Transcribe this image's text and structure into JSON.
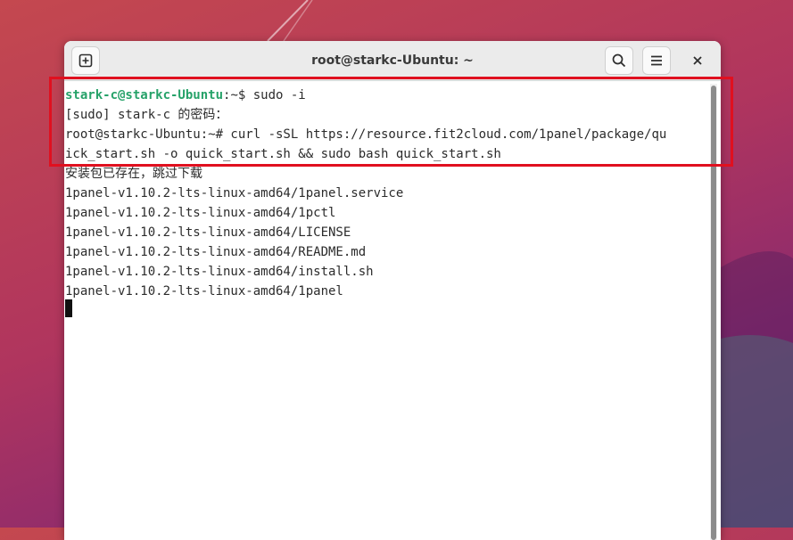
{
  "window": {
    "title": "root@starkc-Ubuntu: ~",
    "close_symbol": "×"
  },
  "terminal": {
    "line1": {
      "user_host": "stark-c@starkc-Ubuntu",
      "rest": ":~$ sudo -i"
    },
    "lines": [
      "[sudo] stark-c 的密码：",
      "root@starkc-Ubuntu:~# curl -sSL https://resource.fit2cloud.com/1panel/package/qu",
      "ick_start.sh -o quick_start.sh && sudo bash quick_start.sh",
      "安装包已存在，跳过下载",
      "1panel-v1.10.2-lts-linux-amd64/1panel.service",
      "1panel-v1.10.2-lts-linux-amd64/1pctl",
      "1panel-v1.10.2-lts-linux-amd64/LICENSE",
      "1panel-v1.10.2-lts-linux-amd64/README.md",
      "1panel-v1.10.2-lts-linux-amd64/install.sh",
      "1panel-v1.10.2-lts-linux-amd64/1panel"
    ]
  },
  "icons": {
    "new_tab": "new-tab-icon",
    "search": "search-icon",
    "menu": "hamburger-menu-icon",
    "close": "close-icon"
  },
  "colors": {
    "prompt_user": "#26a269",
    "highlight": "#e0101f"
  }
}
